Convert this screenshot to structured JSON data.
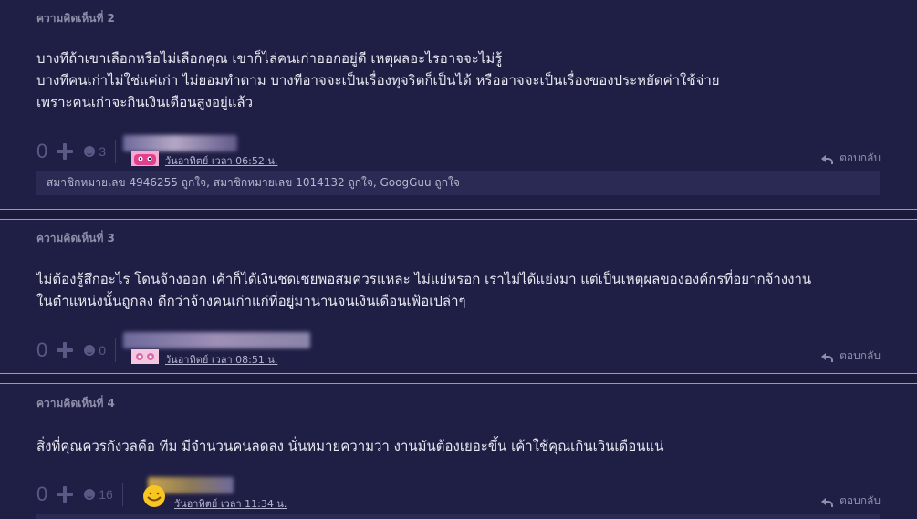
{
  "comments": [
    {
      "title": "ความคิดเห็นที่ 2",
      "lines": [
        "บางทีถ้าเขาเลือกหรือไม่เลือกคุณ เขาก็ไล่คนเก่าออกอยู่ดี เหตุผลอะไรอาจจะไม่รู้",
        "บางทีคนเก่าไม่ใช่แค่เก่า ไม่ยอมทำตาม บางทีอาจจะเป็นเรื่องทุจริตก็เป็นได้ หรืออาจจะเป็นเรื่องของประหยัดค่าใช้จ่าย",
        "เพราะคนเก่าจะกินเงินเดือนสูงอยู่แล้ว"
      ],
      "votes": "0",
      "emoji_count": "3",
      "meta": "วันอาทิตย์ เวลา 06:52 น.",
      "reply": "ตอบกลับ",
      "likers": "สมาชิกหมายเลข 4946255 ถูกใจ, สมาชิกหมายเลข 1014132 ถูกใจ, GoogGuu ถูกใจ"
    },
    {
      "title": "ความคิดเห็นที่ 3",
      "lines": [
        "ไม่ต้องรู้สึกอะไร โดนจ้างออก เค้าก็ได้เงินชดเชยพอสมควรแหละ ไม่แย่หรอก เราไม่ได้แย่งมา แต่เป็นเหตุผลขององค์กรที่อยากจ้างงาน",
        "ในตำแหน่งนั้นถูกลง ดีกว่าจ้างคนเก่าแก่ที่อยู่มานานจนเงินเดือนเฟ้อเปล่าๆ"
      ],
      "votes": "0",
      "emoji_count": "0",
      "meta": "วันอาทิตย์ เวลา 08:51 น.",
      "reply": "ตอบกลับ"
    },
    {
      "title": "ความคิดเห็นที่ 4",
      "lines": [
        "สิ่งที่คุณควรกังวลคือ ทีม มีจำนวนคนลดลง นั่นหมายความว่า งานมันต้องเยอะขึ้น เค้าใช้คุณเกินเวินเดือนแน่"
      ],
      "votes": "0",
      "emoji_count": "16",
      "meta": "วันอาทิตย์ เวลา 11:34 น.",
      "reply": "ตอบกลับ"
    }
  ]
}
